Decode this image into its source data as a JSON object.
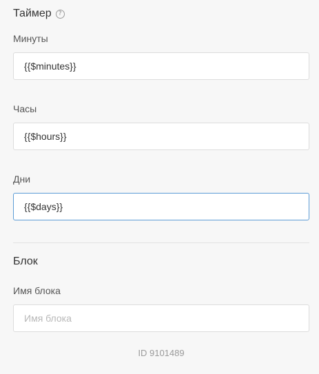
{
  "timer": {
    "title": "Таймер",
    "help_icon": "question-circle-icon",
    "minutes": {
      "label": "Минуты",
      "value": "{{$minutes}}"
    },
    "hours": {
      "label": "Часы",
      "value": "{{$hours}}"
    },
    "days": {
      "label": "Дни",
      "value": "{{$days}}"
    }
  },
  "block": {
    "title": "Блок",
    "name": {
      "label": "Имя блока",
      "value": "",
      "placeholder": "Имя блока"
    }
  },
  "footer": {
    "id_text": "ID 9101489"
  },
  "colors": {
    "background": "#f7f7f7",
    "focus_border": "#5b9bd5"
  }
}
